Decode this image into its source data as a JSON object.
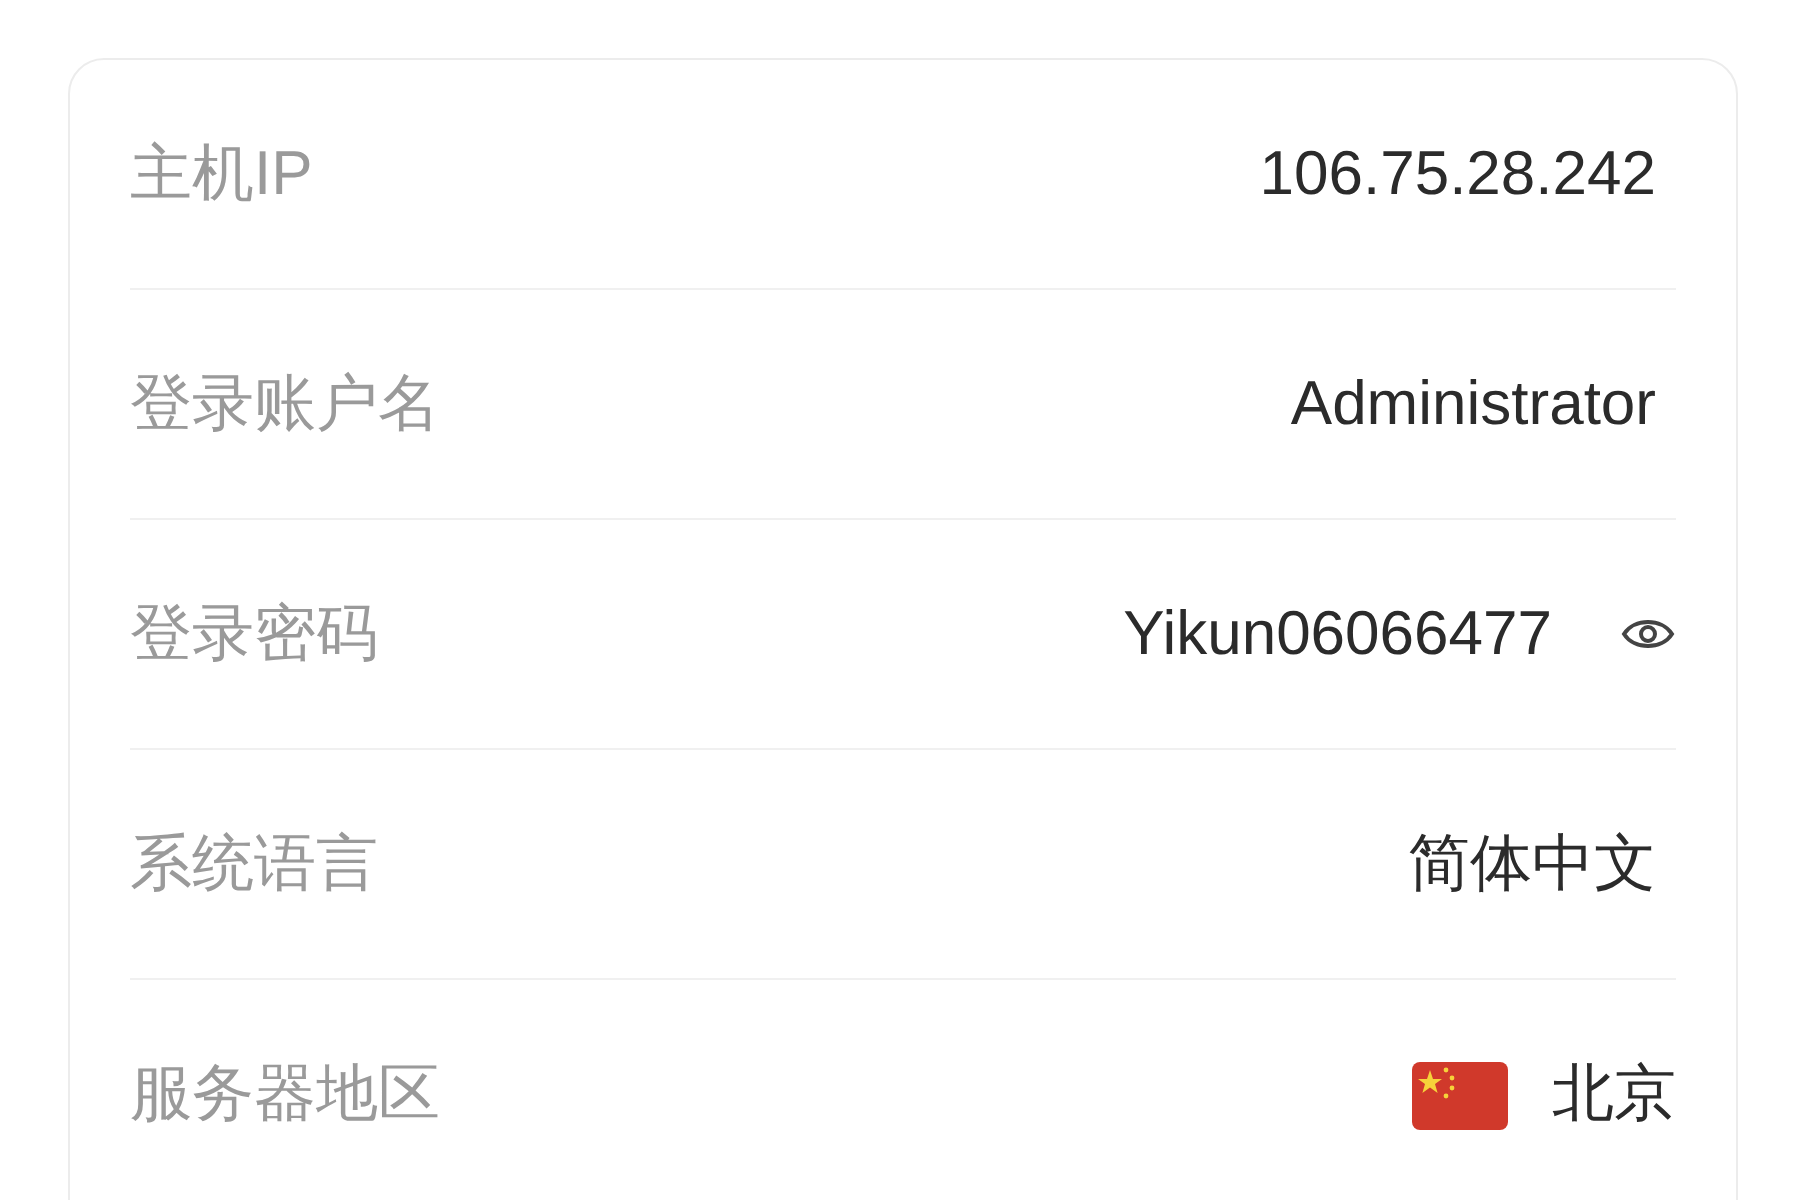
{
  "rows": [
    {
      "kind": "text",
      "label": "主机IP",
      "value": "106.75.28.242"
    },
    {
      "kind": "text",
      "label": "登录账户名",
      "value": "Administrator"
    },
    {
      "kind": "password",
      "label": "登录密码",
      "value": "Yikun06066477"
    },
    {
      "kind": "text",
      "label": "系统语言",
      "value": "简体中文"
    },
    {
      "kind": "region",
      "label": "服务器地区",
      "value": "北京"
    }
  ]
}
